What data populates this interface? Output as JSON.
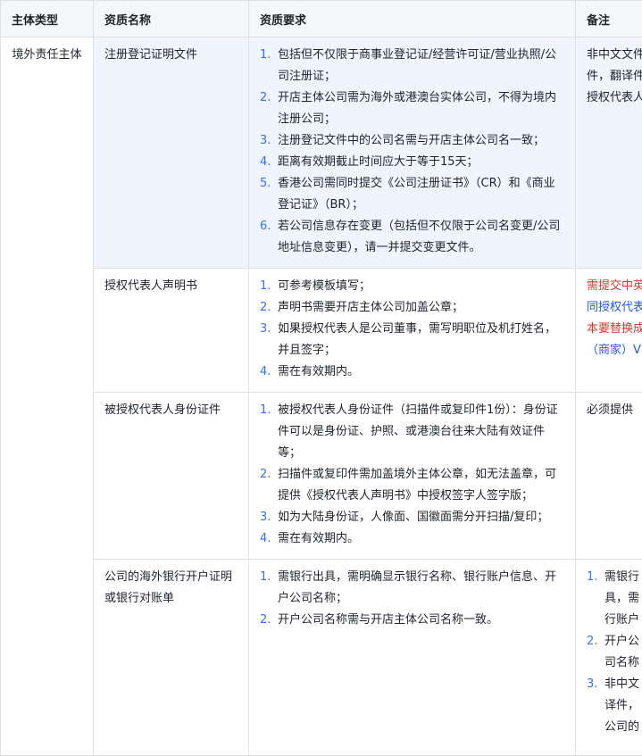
{
  "headers": [
    "主体类型",
    "资质名称",
    "资质要求",
    "备注"
  ],
  "subject_type": "境外责任主体",
  "rows": [
    {
      "name": "注册登记证明文件",
      "requirements": [
        "包括但不仅限于商事业登记证/经营许可证/营业执照/公司注册证；",
        "开店主体公司需为海外或港澳台实体公司，不得为境内注册公司；",
        "注册登记文件中的公司名需与开店主体公司名一致；",
        "距离有效期截止时间应大于等于15天；",
        "香港公司需同时提交《公司注册证书》（CR）和《商业登记证》（BR）；",
        "若公司信息存在变更（包括但不仅限于公司名变更/公司地址信息变更），请一并提交变更文件。"
      ],
      "note_lines": [
        "非中文文件",
        "件，翻译件",
        "授权代表人"
      ]
    },
    {
      "name": "授权代表人声明书",
      "requirements": [
        "可参考模板填写；",
        "声明书需要开店主体公司加盖公章；",
        "如果授权代表人是公司董事，需写明职位及机打姓名，并且签字；",
        "需在有效期内。"
      ],
      "note_lines": [
        "需提交中英",
        "同授权代表",
        "本要替换成",
        "（商家）V"
      ]
    },
    {
      "name": "被授权代表人身份证件",
      "requirements": [
        "被授权代表人身份证件（扫描件或复印件1份）：身份证件可以是身份证、护照、或港澳台往来大陆有效证件等；",
        "扫描件或复印件需加盖境外主体公章，如无法盖章，可提供《授权代表人声明书》中授权签字人签字版；",
        "如为大陆身份证，人像面、国徽面需分开扫描/复印；",
        "需在有效期内。"
      ],
      "note_lines": [
        "必须提供"
      ]
    },
    {
      "name": "公司的海外银行开户证明或银行对账单",
      "requirements": [
        "需银行出具，需明确显示银行名称、银行账户信息、开户公司名称；",
        "开户公司名称需与开店主体公司名称一致。"
      ],
      "note_list": [
        [
          "需银行",
          "具，需",
          "行账户"
        ],
        [
          "开户公",
          "司名称"
        ],
        [
          "非中文",
          "译件，",
          "公司的"
        ]
      ]
    }
  ]
}
